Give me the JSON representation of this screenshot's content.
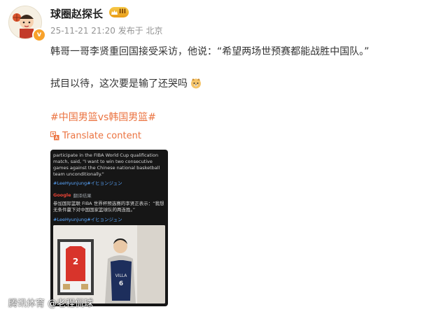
{
  "author": {
    "name": "球圈赵探长",
    "level": "III",
    "verified_mark": "v"
  },
  "meta": {
    "timestamp": "25-11-21 21:20",
    "published_from": "发布于 北京"
  },
  "post": {
    "line1": "韩哥一哥李贤重回国接受采访，他说：“希望两场世预赛都能战胜中国队。”",
    "line2": "拭目以待，这次要是输了还哭吗",
    "hashtag": "#中国男篮vs韩国男篮#",
    "translate_label": "Translate content"
  },
  "media": {
    "english_caption": "participate in the FIBA World Cup qualification match, said, \"I want to win two consecutive games against the Chinese national basketball team unconditionally.\"",
    "tag1": "#LeeHyunjung#イヒョンジュン",
    "google_label": "Google",
    "google_sub": "翻译结果",
    "chinese_caption": "参加国际篮联 FIBA 世界杯预选赛的李贤正表示：“我想无条件赢下对中国国家篮球队的两连胜。”",
    "tag2": "#LeeHyunjung#イヒョンジュン",
    "jersey_number": "2"
  },
  "watermark": "腾讯体育 @老程侃球",
  "colors": {
    "accent": "#eb7340",
    "meta": "#939393",
    "text": "#333333"
  },
  "icons": {
    "verified": "verified-badge-icon",
    "translate": "translate-icon",
    "emoji": "dog-emoji-icon"
  }
}
